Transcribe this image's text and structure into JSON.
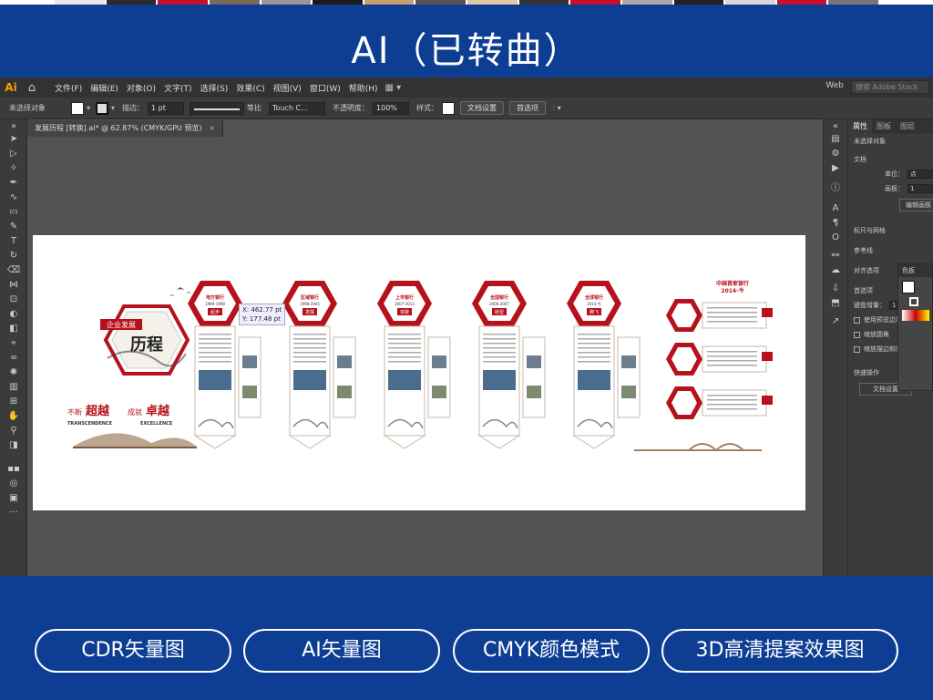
{
  "banner": {
    "title": "AI（已转曲）"
  },
  "menubar": {
    "logo": "Ai",
    "menus": [
      "文件(F)",
      "编辑(E)",
      "对象(O)",
      "文字(T)",
      "选择(S)",
      "效果(C)",
      "视图(V)",
      "窗口(W)",
      "帮助(H)"
    ],
    "workspace": "Web",
    "search_placeholder": "搜索 Adobe Stock"
  },
  "control_bar": {
    "selection": "未选择对象",
    "stroke_label": "描边：",
    "stroke_value": "1 pt",
    "profile": "等比",
    "brush": "Touch C...",
    "opacity_label": "不透明度：",
    "opacity_value": "100%",
    "style_label": "样式：",
    "doc_setup": "文档设置",
    "prefs": "首选项"
  },
  "document_tab": {
    "title": "发展历程 [转换].ai* @ 62.87% (CMYK/GPU 预览)",
    "close": "×"
  },
  "tooltip": {
    "x": "X: 462.77 pt",
    "y": "Y: 177.48 pt"
  },
  "panel": {
    "tabs": [
      "属性",
      "图板",
      "图层"
    ],
    "no_selection": "未选择对象",
    "document": "文档",
    "units_label": "单位：",
    "units_value": "点",
    "artboard_label": "画板：",
    "artboard_value": "1",
    "edit_artboard": "编辑画板",
    "rulers_grid": "标尺与网格",
    "guides": "参考线",
    "align": "对齐选项",
    "prefs": "首选项",
    "keyboard_increment_label": "键盘增量：",
    "keyboard_increment_value": "1",
    "use_preview_bounds": "使用预览边界",
    "scale_corners": "缩放圆角",
    "scale_strokes": "缩放描边和效果",
    "quick_actions": "快速操作",
    "doc_setup_btn": "文档设置",
    "swatch_panel_title": "色板"
  },
  "design": {
    "badge_text": "企业发展",
    "title_text": "历程",
    "slogan_1a": "不断",
    "slogan_1b": "超越",
    "slogan_2a": "成就",
    "slogan_2b": "卓越",
    "eng_1": "TRANSCENDENCE",
    "eng_2": "EXCELLENCE",
    "stages": [
      {
        "name": "地方银行",
        "years": "1989-1998",
        "tag": "起步"
      },
      {
        "name": "区域银行",
        "years": "1998-2005",
        "tag": "发展"
      },
      {
        "name": "上市银行",
        "years": "2007-2013",
        "tag": "突破"
      },
      {
        "name": "全国银行",
        "years": "2008-2007",
        "tag": "转型"
      },
      {
        "name": "全球银行",
        "years": "2014-今",
        "tag": "腾飞"
      }
    ],
    "right_title": "中国首家银行",
    "right_years": "2014-今"
  },
  "footer": {
    "pills": [
      "CDR矢量图",
      "AI矢量图",
      "CMYK颜色模式",
      "3D高清提案效果图"
    ]
  },
  "colors": {
    "brand_blue": "#0d3e93",
    "accent_red": "#b5121b",
    "ui_dark": "#535353",
    "ai_orange": "#ff9a00"
  }
}
